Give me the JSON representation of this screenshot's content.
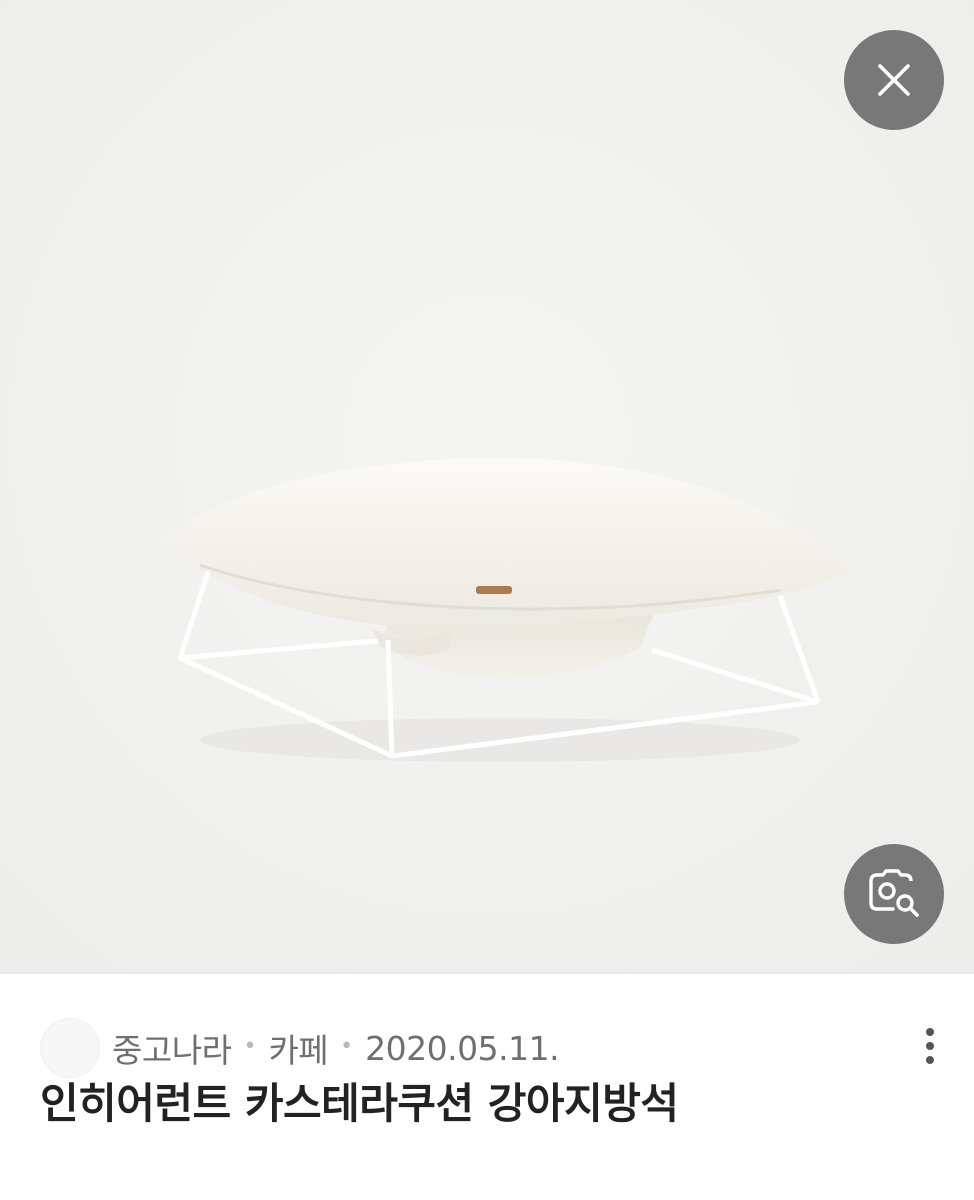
{
  "viewer": {
    "image_subject": "white square cushion on a thin white wire frame bed",
    "close_icon": "close-icon",
    "lens_icon": "image-search-icon"
  },
  "result": {
    "source_name": "중고나라",
    "source_type": "카페",
    "date": "2020.05.11.",
    "separator": "•",
    "title": "인히어런트 카스테라쿠션 강아지방석",
    "more_icon": "more-vertical-icon"
  }
}
